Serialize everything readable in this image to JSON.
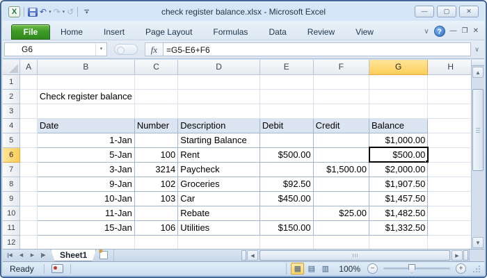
{
  "window": {
    "title": "check register balance.xlsx  -  Microsoft Excel",
    "controls": {
      "minimize": "—",
      "maximize": "▢",
      "close": "✕"
    }
  },
  "qat": {
    "excel_logo": "X",
    "undo_icon": "↶",
    "redo_icon": "↷",
    "repeat_icon": "↺",
    "dropdown_icon": "▾",
    "more_icon": "▾"
  },
  "ribbon": {
    "file_tab": "File",
    "tabs": [
      "Home",
      "Insert",
      "Page Layout",
      "Formulas",
      "Data",
      "Review",
      "View"
    ],
    "collapse_icon": "∨",
    "help_icon": "?",
    "doc_controls": {
      "minimize": "—",
      "restore": "❐",
      "close": "✕"
    }
  },
  "formula_bar": {
    "name_box": "G6",
    "dropdown_icon": "▾",
    "fx_icon": "fx",
    "formula": "=G5-E6+F6",
    "expand_icon": "∨"
  },
  "sheet": {
    "column_labels": [
      "A",
      "B",
      "C",
      "D",
      "E",
      "F",
      "G",
      "H"
    ],
    "row_labels": [
      "1",
      "2",
      "3",
      "4",
      "5",
      "6",
      "7",
      "8",
      "9",
      "10",
      "11",
      "12"
    ],
    "selected": {
      "cell_ref": "G6",
      "col": "G",
      "row": 6
    },
    "title_cell": {
      "ref": "B2",
      "text": "Check register balance"
    },
    "table": {
      "start_col": "B",
      "header_row": 4,
      "headers": [
        "Date",
        "Number",
        "Description",
        "Debit",
        "Credit",
        "Balance"
      ],
      "rows": [
        [
          "1-Jan",
          "",
          "Starting Balance",
          "",
          "",
          "$1,000.00"
        ],
        [
          "5-Jan",
          "100",
          "Rent",
          "$500.00",
          "",
          "$500.00"
        ],
        [
          "3-Jan",
          "3214",
          "Paycheck",
          "",
          "$1,500.00",
          "$2,000.00"
        ],
        [
          "9-Jan",
          "102",
          "Groceries",
          "$92.50",
          "",
          "$1,907.50"
        ],
        [
          "10-Jan",
          "103",
          "Car",
          "$450.00",
          "",
          "$1,457.50"
        ],
        [
          "11-Jan",
          "",
          "Rebate",
          "",
          "$25.00",
          "$1,482.50"
        ],
        [
          "15-Jan",
          "106",
          "Utilities",
          "$150.00",
          "",
          "$1,332.50"
        ]
      ]
    }
  },
  "tabs_bar": {
    "sheets": [
      "Sheet1"
    ],
    "active_sheet": "Sheet1",
    "nav_icons": {
      "first": "◀",
      "previous": "◀",
      "next": "▶",
      "last": "▶"
    },
    "scroll_icons": {
      "left": "◀",
      "right": "▶",
      "up": "▲",
      "down": "▼"
    }
  },
  "status_bar": {
    "mode": "Ready",
    "zoom_level": "100%",
    "view_icons": {
      "normal": "▦",
      "page_layout": "▤",
      "page_break": "▥"
    },
    "zoom_out": "−",
    "zoom_in": "+"
  },
  "colors": {
    "file_tab_green": "#3f9b28",
    "selected_header_fill": "#fcce58",
    "table_header_fill": "#dbe5f1",
    "selection_border": "#000000",
    "window_frame": "#bcd4ec"
  }
}
